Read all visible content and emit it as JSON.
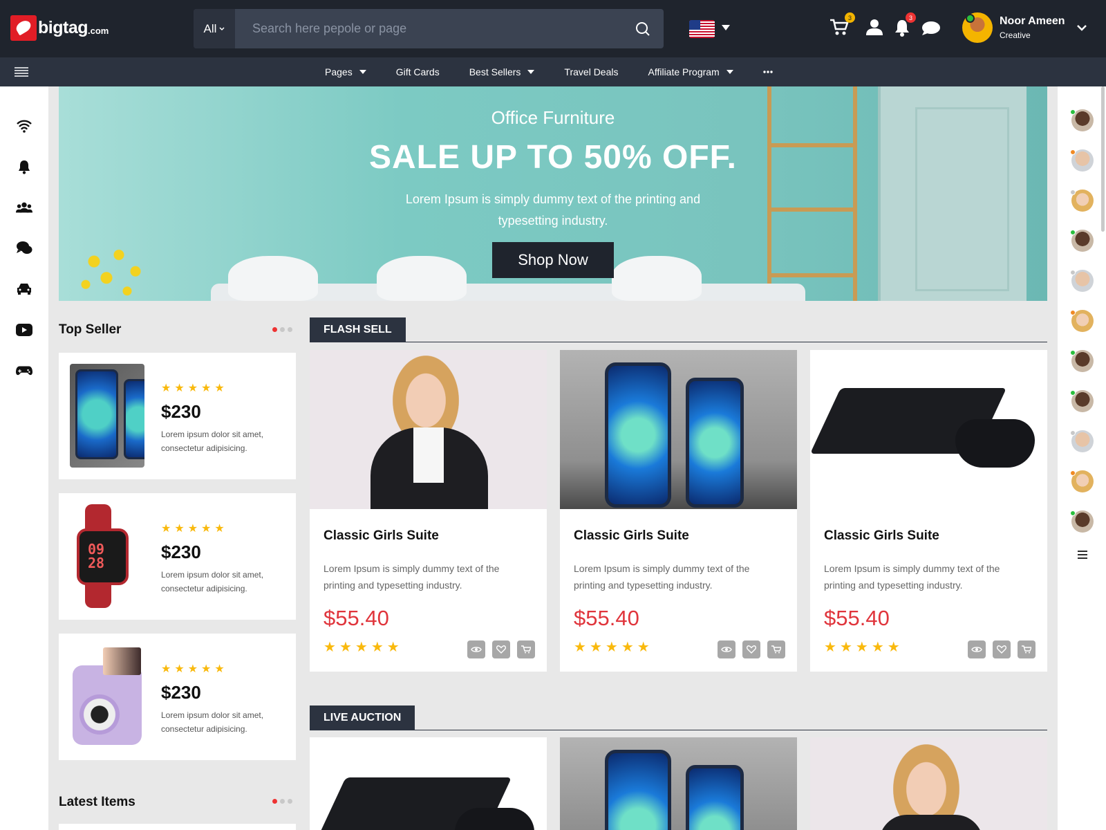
{
  "brand": {
    "name": "bigtag",
    "domain": ".com"
  },
  "search": {
    "category": "All",
    "placeholder": "Search here pepole or page"
  },
  "header": {
    "cart_badge": "3",
    "notif_badge": "3",
    "user": {
      "name": "Noor Ameen",
      "role": "Creative"
    }
  },
  "nav": {
    "items": [
      {
        "label": "Pages",
        "dropdown": true
      },
      {
        "label": "Gift Cards",
        "dropdown": false
      },
      {
        "label": "Best Sellers",
        "dropdown": true
      },
      {
        "label": "Travel Deals",
        "dropdown": false
      },
      {
        "label": "Affiliate Program",
        "dropdown": true
      }
    ]
  },
  "left_sidebar": {
    "icons": [
      "wifi-icon",
      "bell-icon",
      "group-icon",
      "chat-icon",
      "car-icon",
      "youtube-icon",
      "gamepad-icon"
    ]
  },
  "hero": {
    "subtitle": "Office Furniture",
    "title": "SALE UP TO 50% OFF.",
    "text": "Lorem Ipsum is simply dummy text of the printing and typesetting industry.",
    "button": "Shop Now"
  },
  "top_seller": {
    "title": "Top Seller",
    "items": [
      {
        "image": "iphone",
        "rating": 5,
        "price": "$230",
        "desc": "Lorem ipsum dolor sit amet, consectetur adipisicing."
      },
      {
        "image": "smartwatch",
        "rating": 5,
        "price": "$230",
        "desc": "Lorem ipsum dolor sit amet, consectetur adipisicing."
      },
      {
        "image": "instant-camera",
        "rating": 5,
        "price": "$230",
        "desc": "Lorem ipsum dolor sit amet, consectetur adipisicing."
      }
    ]
  },
  "latest_items": {
    "title": "Latest Items"
  },
  "flash_sell": {
    "title": "FLASH SELL",
    "products": [
      {
        "image": "businesswoman",
        "name": "Classic Girls Suite",
        "desc": "Lorem Ipsum is simply dummy text of the printing and typesetting industry.",
        "price": "$55.40",
        "rating": 5
      },
      {
        "image": "iphone",
        "name": "Classic Girls Suite",
        "desc": "Lorem Ipsum is simply dummy text of the printing and typesetting industry.",
        "price": "$55.40",
        "rating": 5
      },
      {
        "image": "game-console",
        "name": "Classic Girls Suite",
        "desc": "Lorem Ipsum is simply dummy text of the printing and typesetting industry.",
        "price": "$55.40",
        "rating": 5
      }
    ]
  },
  "live_auction": {
    "title": "LIVE AUCTION",
    "products": [
      {
        "image": "game-console"
      },
      {
        "image": "iphone"
      },
      {
        "image": "businesswoman"
      }
    ]
  },
  "colors": {
    "header_bg": "#1f242d",
    "nav_bg": "#2c3340",
    "accent_red": "#e0353c",
    "star": "#f9b90d",
    "hero_teal": "#7ccac3"
  }
}
